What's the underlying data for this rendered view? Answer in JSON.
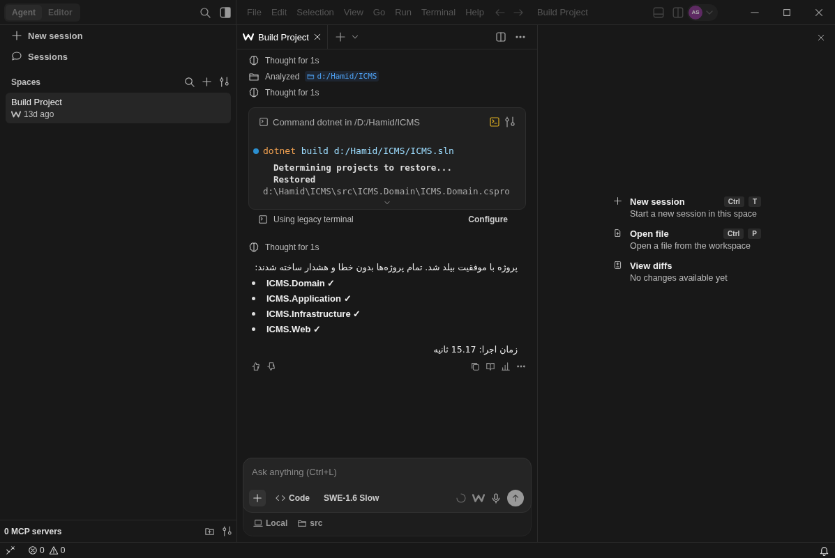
{
  "sidebar": {
    "mode_tabs": [
      {
        "label": "Agent",
        "selected": true
      },
      {
        "label": "Editor",
        "selected": false
      }
    ],
    "nav": [
      {
        "kind": "new",
        "label": "New session"
      },
      {
        "kind": "sessions",
        "label": "Sessions"
      }
    ],
    "spaces_label": "Spaces",
    "sessions": [
      {
        "title": "Build Project",
        "time": "13d ago",
        "selected": true
      }
    ],
    "mcp": "0 MCP servers"
  },
  "menu": [
    "File",
    "Edit",
    "Selection",
    "View",
    "Go",
    "Run",
    "Terminal",
    "Help"
  ],
  "window": {
    "title": "Build Project",
    "avatar": "AS"
  },
  "tabs": [
    {
      "label": "Build Project",
      "selected": true
    }
  ],
  "chat": {
    "steps": [
      {
        "kind": "thought",
        "text": "Thought for 1s"
      },
      {
        "kind": "analyzed",
        "text": "Analyzed",
        "path": "d:/Hamid/ICMS"
      },
      {
        "kind": "thought",
        "text": "Thought for 1s"
      }
    ],
    "command": {
      "title": "Command dotnet in /D:/Hamid/ICMS",
      "program": "dotnet",
      "args": "build d:/Hamid/ICMS/ICMS.sln",
      "output": [
        "  Determining projects to restore...",
        "  Restored"
      ],
      "path_line": "d:\\Hamid\\ICMS\\src\\ICMS.Domain\\ICMS.Domain.cspro",
      "note": "Using legacy terminal",
      "action": "Configure"
    },
    "after_steps": [
      {
        "kind": "thought",
        "text": "Thought for 1s"
      }
    ],
    "answer": {
      "intro": "پروژه با موفقیت بیلد شد. تمام پروژه‌ها بدون خطا و هشدار ساخته شدند:",
      "items": [
        "ICMS.Domain ✓",
        "ICMS.Application ✓",
        "ICMS.Infrastructure ✓",
        "ICMS.Web ✓"
      ],
      "runtime": "زمان اجرا: 15.17 ثانیه"
    }
  },
  "input": {
    "placeholder": "Ask anything (Ctrl+L)",
    "mode": "Code",
    "model": "SWE-1.6 Slow",
    "context": [
      {
        "kind": "machine",
        "label": "Local"
      },
      {
        "kind": "folder",
        "label": "src"
      }
    ]
  },
  "panel": {
    "actions": [
      {
        "kind": "new",
        "title": "New session",
        "description": "Start a new session in this space",
        "keys": [
          "Ctrl",
          "T"
        ]
      },
      {
        "kind": "file",
        "title": "Open file",
        "description": "Open a file from the workspace",
        "keys": [
          "Ctrl",
          "P"
        ]
      },
      {
        "kind": "diff",
        "title": "View diffs",
        "description": "No changes available yet"
      }
    ]
  },
  "status_bar": {
    "errors": "0",
    "warnings": "0"
  }
}
